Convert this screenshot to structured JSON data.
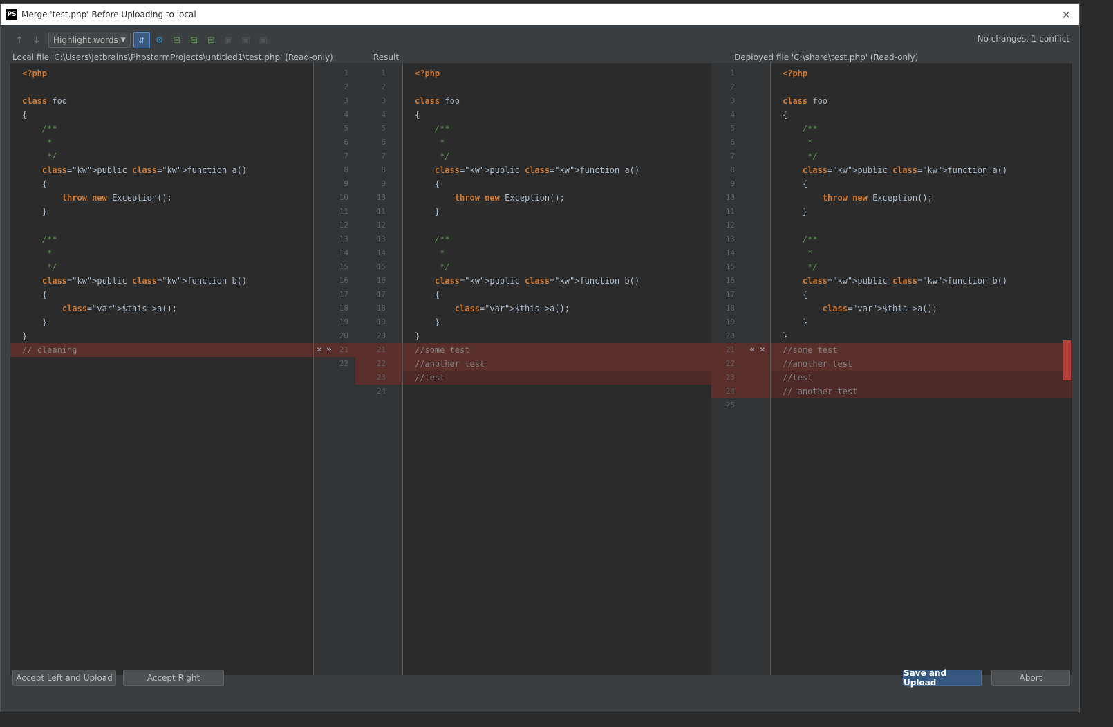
{
  "window": {
    "title": "Merge 'test.php' Before Uploading to local",
    "logo": "PS"
  },
  "toolbar": {
    "highlight_mode": "Highlight words",
    "status": "No changes. 1 conflict"
  },
  "panes": {
    "left_header": "Local file 'C:\\Users\\jetbrains\\PhpstormProjects\\untitled1\\test.php' (Read-only)",
    "center_header": "Result",
    "right_header": "Deployed file 'C:\\share\\test.php' (Read-only)"
  },
  "left_code": [
    "<?php",
    "",
    "class foo",
    "{",
    "    /**",
    "     *",
    "     */",
    "    public function a()",
    "    {",
    "        throw new Exception();",
    "    }",
    "",
    "    /**",
    "     *",
    "     */",
    "    public function b()",
    "    {",
    "        $this->a();",
    "    }",
    "}",
    "// cleaning"
  ],
  "center_code": [
    "<?php",
    "",
    "class foo",
    "{",
    "    /**",
    "     *",
    "     */",
    "    public function a()",
    "    {",
    "        throw new Exception();",
    "    }",
    "",
    "    /**",
    "     *",
    "     */",
    "    public function b()",
    "    {",
    "        $this->a();",
    "    }",
    "}",
    "//some test",
    "//another test",
    "//test"
  ],
  "right_code": [
    "<?php",
    "",
    "class foo",
    "{",
    "    /**",
    "     *",
    "     */",
    "    public function a()",
    "    {",
    "        throw new Exception();",
    "    }",
    "",
    "    /**",
    "     *",
    "     */",
    "    public function b()",
    "    {",
    "        $this->a();",
    "    }",
    "}",
    "//some test",
    "//another test",
    "//test",
    "// another test"
  ],
  "left_line_numbers": [
    "1",
    "2",
    "3",
    "4",
    "5",
    "6",
    "7",
    "8",
    "9",
    "10",
    "11",
    "12",
    "13",
    "14",
    "15",
    "16",
    "17",
    "18",
    "19",
    "20",
    "21",
    "22"
  ],
  "center_line_numbers": [
    "1",
    "2",
    "3",
    "4",
    "5",
    "6",
    "7",
    "8",
    "9",
    "10",
    "11",
    "12",
    "13",
    "14",
    "15",
    "16",
    "17",
    "18",
    "19",
    "20",
    "21",
    "22",
    "23",
    "24"
  ],
  "right_line_numbers": [
    "1",
    "2",
    "3",
    "4",
    "5",
    "6",
    "7",
    "8",
    "9",
    "10",
    "11",
    "12",
    "13",
    "14",
    "15",
    "16",
    "17",
    "18",
    "19",
    "20",
    "21",
    "22",
    "23",
    "24",
    "25"
  ],
  "buttons": {
    "accept_left": "Accept Left and Upload",
    "accept_right": "Accept Right",
    "save": "Save and Upload",
    "abort": "Abort"
  },
  "icons": {
    "left_accept": "»",
    "left_reject": "✕",
    "right_accept": "«",
    "right_reject": "✕",
    "prev": "up-arrow-icon",
    "next": "down-arrow-icon"
  },
  "colors": {
    "conflict": "#5a2e2b",
    "keyword": "#cc7832",
    "doc_comment": "#629755",
    "primary_button": "#365880"
  }
}
